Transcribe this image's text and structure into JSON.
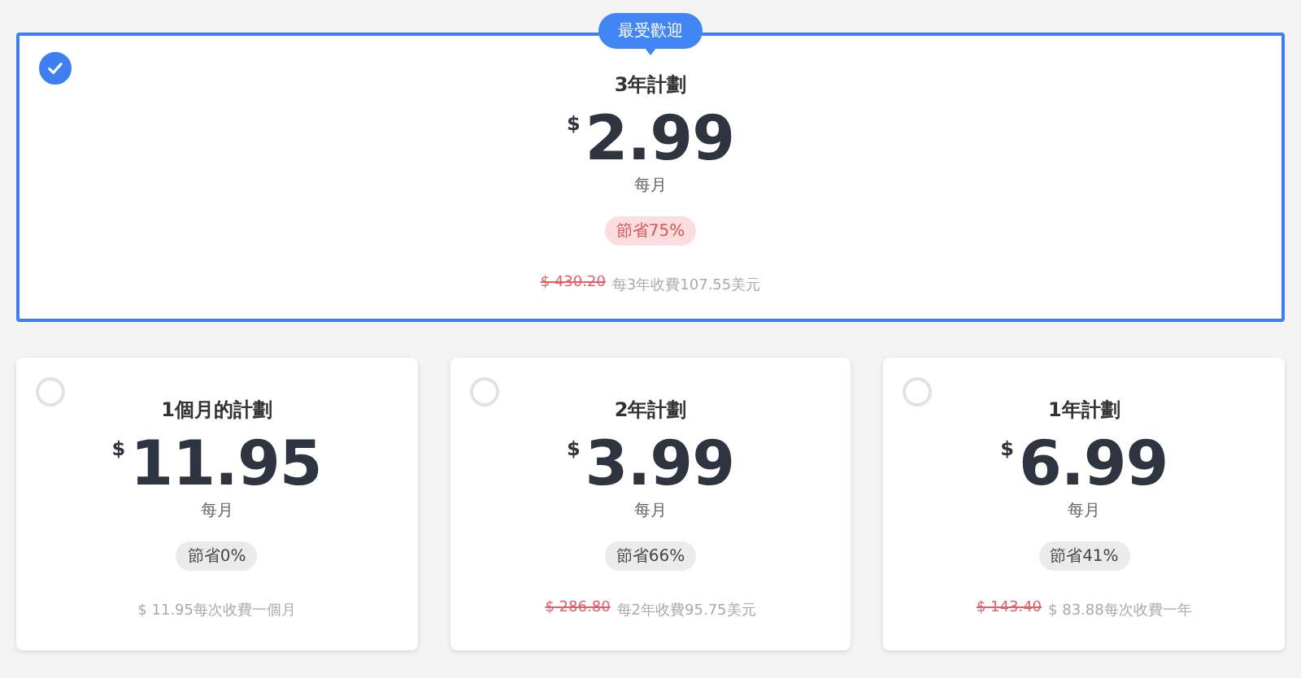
{
  "plans": [
    {
      "selected": true,
      "tag": "最受歡迎",
      "name": "3年計劃",
      "currency": "$",
      "price": "2.99",
      "period": "每月",
      "savings": {
        "label": "節省75%",
        "highlighted": true
      },
      "original_price": "$ 430.20",
      "billing": "每3年收費107.55美元"
    },
    {
      "selected": false,
      "name": "1個月的計劃",
      "currency": "$",
      "price": "11.95",
      "period": "每月",
      "savings": {
        "label": "節省0%",
        "highlighted": false
      },
      "billing": "$ 11.95每次收費一個月"
    },
    {
      "selected": false,
      "name": "2年計劃",
      "currency": "$",
      "price": "3.99",
      "period": "每月",
      "savings": {
        "label": "節省66%",
        "highlighted": false
      },
      "original_price": "$ 286.80",
      "billing": "每2年收費95.75美元"
    },
    {
      "selected": false,
      "name": "1年計劃",
      "currency": "$",
      "price": "6.99",
      "period": "每月",
      "savings": {
        "label": "節省41%",
        "highlighted": false
      },
      "original_price": "$ 143.40",
      "billing": "$ 83.88每次收費一年"
    }
  ]
}
